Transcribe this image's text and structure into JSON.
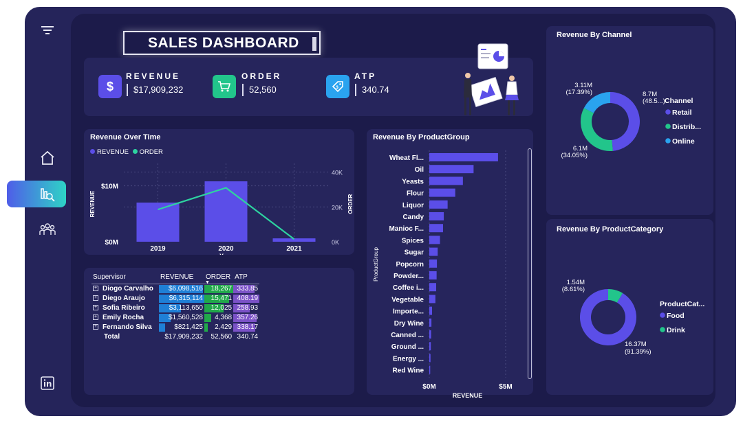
{
  "dashboard_title": "SALES DASHBOARD",
  "kpis": [
    {
      "label": "REVENUE",
      "value": "$17,909,232",
      "icon": "dollar-icon",
      "symbol": "$",
      "color": "#5b4ee8"
    },
    {
      "label": "ORDER",
      "value": "52,560",
      "icon": "cart-icon",
      "symbol": "🛒",
      "color": "#22c58b"
    },
    {
      "label": "ATP",
      "value": "340.74",
      "icon": "price-tag-icon",
      "symbol": "🏷",
      "color": "#2aa3ef"
    }
  ],
  "revenue_over_time": {
    "title": "Revenue Over Time",
    "legend": [
      "REVENUE",
      "ORDER"
    ],
    "y_left_ticks": [
      "$10M",
      "$0M"
    ],
    "y_right_ticks": [
      "40K",
      "20K",
      "0K"
    ],
    "y_left_label": "REVENUE",
    "y_right_label": "ORDER",
    "x_label": "Year"
  },
  "revenue_by_productgroup": {
    "title": "Revenue By ProductGroup",
    "y_label": "ProductGroup",
    "x_label": "REVENUE",
    "x_ticks": [
      "$0M",
      "$5M"
    ]
  },
  "revenue_by_channel": {
    "title": "Revenue By Channel",
    "legend_title": "Channel",
    "legend": [
      "Retail",
      "Distrib...",
      "Online"
    ],
    "labels": [
      {
        "value": "8.7M",
        "pct": "(48.5...)"
      },
      {
        "value": "6.1M",
        "pct": "(34.05%)"
      },
      {
        "value": "3.11M",
        "pct": "(17.39%)"
      }
    ]
  },
  "revenue_by_productcategory": {
    "title": "Revenue By ProductCategory",
    "legend_title": "ProductCat...",
    "legend": [
      "Food",
      "Drink"
    ],
    "labels": [
      {
        "value": "1.54M",
        "pct": "(8.61%)"
      },
      {
        "value": "16.37M",
        "pct": "(91.39%)"
      }
    ]
  },
  "supervisor_table": {
    "headers": [
      "Supervisor",
      "REVENUE",
      "ORDER",
      "ATP"
    ],
    "rows": [
      {
        "name": "Diogo Carvalho",
        "revenue": "$6,098,516",
        "order": "18,267",
        "atp": "333.85",
        "rev_frac": 0.97,
        "order_frac": 1.0,
        "atp_frac": 0.82
      },
      {
        "name": "Diego Araujo",
        "revenue": "$6,315,114",
        "order": "15,471",
        "atp": "408.19",
        "rev_frac": 1.0,
        "order_frac": 0.85,
        "atp_frac": 1.0
      },
      {
        "name": "Sofia Ribeiro",
        "revenue": "$3,113,650",
        "order": "12,025",
        "atp": "258.93",
        "rev_frac": 0.49,
        "order_frac": 0.66,
        "atp_frac": 0.63
      },
      {
        "name": "Emily Rocha",
        "revenue": "$1,560,528",
        "order": "4,368",
        "atp": "357.26",
        "rev_frac": 0.25,
        "order_frac": 0.24,
        "atp_frac": 0.88
      },
      {
        "name": "Fernando Silva",
        "revenue": "$821,425",
        "order": "2,429",
        "atp": "338.17",
        "rev_frac": 0.13,
        "order_frac": 0.13,
        "atp_frac": 0.83
      }
    ],
    "total": {
      "name": "Total",
      "revenue": "$17,909,232",
      "order": "52,560",
      "atp": "340.74"
    },
    "colors": {
      "revenue": "#1f7fd6",
      "order": "#21a84a",
      "atp": "#7b52c7"
    }
  },
  "chart_data": [
    {
      "type": "bar",
      "title": "Revenue Over Time",
      "categories": [
        "2019",
        "2020",
        "2021"
      ],
      "series": [
        {
          "name": "REVENUE",
          "type": "bar",
          "values": [
            7000000,
            10800000,
            600000
          ],
          "color": "#5b4ee8"
        },
        {
          "name": "ORDER",
          "type": "line",
          "values": [
            18500,
            31000,
            1500
          ],
          "color": "#2ed3a0"
        }
      ],
      "xlabel": "Year",
      "ylabel": "REVENUE",
      "y2label": "ORDER",
      "ylim": [
        0,
        14000000
      ],
      "y2lim": [
        0,
        45000
      ]
    },
    {
      "type": "bar",
      "orientation": "horizontal",
      "title": "Revenue By ProductGroup",
      "categories": [
        "Wheat Fl...",
        "Oil",
        "Yeasts",
        "Flour",
        "Liquor",
        "Candy",
        "Manioc F...",
        "Spices",
        "Sugar",
        "Popcorn",
        "Powder...",
        "Coffee i...",
        "Vegetable",
        "Importe...",
        "Dry Wine",
        "Canned ...",
        "Ground ...",
        "Energy ...",
        "Red Wine"
      ],
      "values": [
        4.5,
        2.9,
        2.2,
        1.7,
        1.2,
        0.95,
        0.9,
        0.7,
        0.55,
        0.5,
        0.48,
        0.45,
        0.4,
        0.18,
        0.14,
        0.12,
        0.1,
        0.08,
        0.06
      ],
      "xlabel": "REVENUE",
      "ylabel": "ProductGroup",
      "xlim": [
        0,
        5.5
      ],
      "color": "#5b4ee8"
    },
    {
      "type": "pie",
      "title": "Revenue By Channel",
      "labels": [
        "Retail",
        "Distrib...",
        "Online"
      ],
      "values": [
        48.56,
        34.05,
        17.39
      ],
      "colors": [
        "#5b4ee8",
        "#22c58b",
        "#2aa3ef"
      ]
    },
    {
      "type": "pie",
      "title": "Revenue By ProductCategory",
      "labels": [
        "Food",
        "Drink"
      ],
      "values": [
        91.39,
        8.61
      ],
      "colors": [
        "#5b4ee8",
        "#22c58b"
      ]
    }
  ]
}
